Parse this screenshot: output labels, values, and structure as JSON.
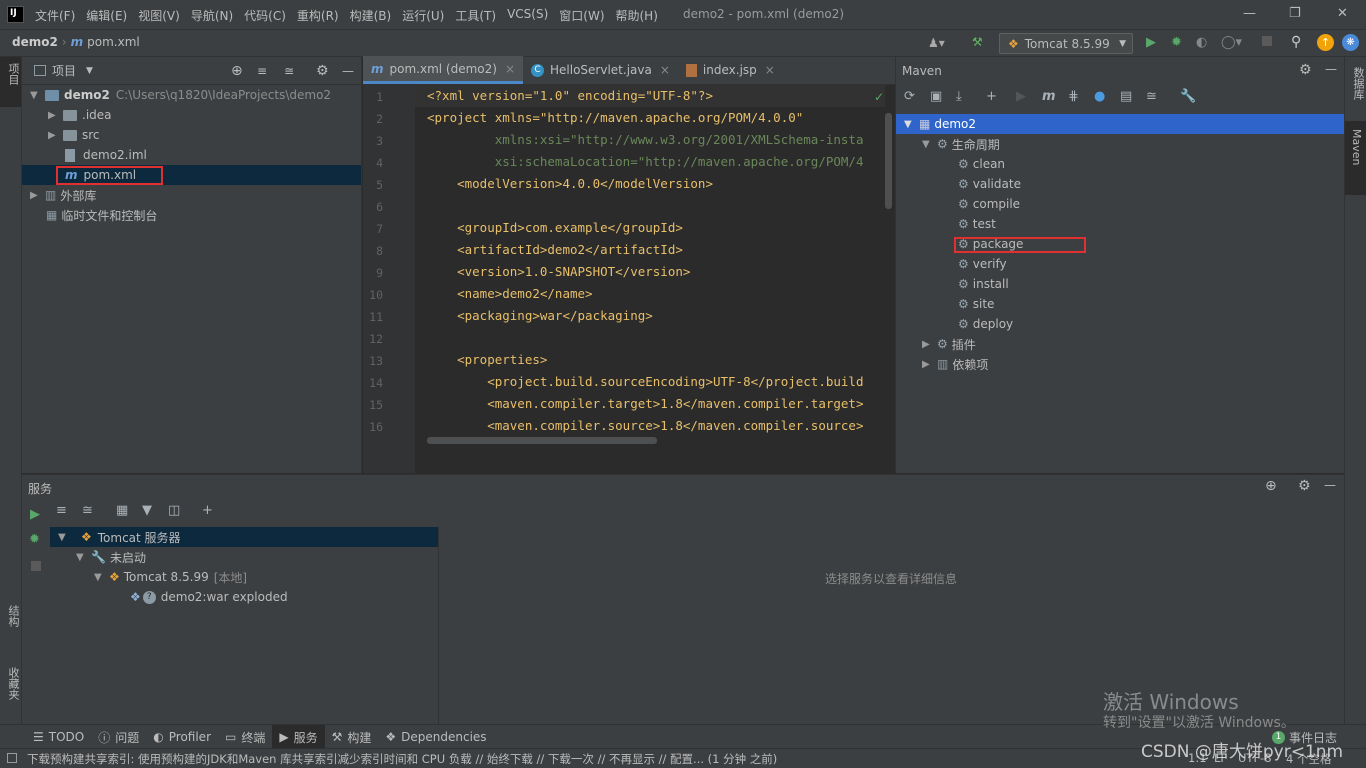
{
  "titlebar": {
    "logo": "IJ",
    "menu": [
      "文件(F)",
      "编辑(E)",
      "视图(V)",
      "导航(N)",
      "代码(C)",
      "重构(R)",
      "构建(B)",
      "运行(U)",
      "工具(T)",
      "VCS(S)",
      "窗口(W)",
      "帮助(H)"
    ],
    "title": "demo2 - pom.xml (demo2)"
  },
  "navbar": {
    "crumb_project": "demo2",
    "crumb_file": "pom.xml",
    "run_config": "Tomcat 8.5.99"
  },
  "left_stripe": {
    "project": "项目",
    "structure": "结构",
    "favorites": "收藏夹"
  },
  "right_stripe": {
    "database": "数据库",
    "maven": "Maven"
  },
  "project": {
    "header": "项目",
    "root_name": "demo2",
    "root_path": "C:\\Users\\q1820\\IdeaProjects\\demo2",
    "items": [
      ".idea",
      "src",
      "demo2.iml",
      "pom.xml",
      "外部库",
      "临时文件和控制台"
    ]
  },
  "editor": {
    "tabs": [
      "pom.xml (demo2)",
      "HelloServlet.java",
      "index.jsp"
    ],
    "line_numbers": [
      "1",
      "2",
      "3",
      "4",
      "5",
      "6",
      "7",
      "8",
      "9",
      "10",
      "11",
      "12",
      "13",
      "14",
      "15",
      "16"
    ],
    "lines": [
      "<?xml version=\"1.0\" encoding=\"UTF-8\"?>",
      "<project xmlns=\"http://maven.apache.org/POM/4.0.0\"",
      "         xmlns:xsi=\"http://www.w3.org/2001/XMLSchema-insta",
      "         xsi:schemaLocation=\"http://maven.apache.org/POM/4",
      "    <modelVersion>4.0.0</modelVersion>",
      "",
      "    <groupId>com.example</groupId>",
      "    <artifactId>demo2</artifactId>",
      "    <version>1.0-SNAPSHOT</version>",
      "    <name>demo2</name>",
      "    <packaging>war</packaging>",
      "",
      "    <properties>",
      "        <project.build.sourceEncoding>UTF-8</project.build",
      "        <maven.compiler.target>1.8</maven.compiler.target>",
      "        <maven.compiler.source>1.8</maven.compiler.source>"
    ]
  },
  "maven": {
    "header": "Maven",
    "root": "demo2",
    "lifecycle": "生命周期",
    "phases": [
      "clean",
      "validate",
      "compile",
      "test",
      "package",
      "verify",
      "install",
      "site",
      "deploy"
    ],
    "plugins": "插件",
    "deps": "依赖项"
  },
  "services": {
    "header": "服务",
    "tomcat_server": "Tomcat 服务器",
    "not_started": "未启动",
    "tomcat_instance": "Tomcat 8.5.99",
    "local_tag": "[本地]",
    "artifact": "demo2:war exploded",
    "detail_hint": "选择服务以查看详细信息"
  },
  "bottom_tabs": [
    "TODO",
    "问题",
    "Profiler",
    "终端",
    "服务",
    "构建",
    "Dependencies"
  ],
  "event_log": "事件日志",
  "event_badge": "1",
  "status": {
    "message": "下载预构建共享索引: 使用预构建的JDK和Maven 库共享索引减少索引时间和 CPU 负载 // 始终下载 // 下载一次 // 不再显示 // 配置... (1 分钟 之前)",
    "position": "1:1",
    "lf": "LF",
    "encoding": "UTF-8",
    "indent": "4 个空格"
  },
  "watermark": {
    "activate_title": "激活 Windows",
    "activate_sub": "转到\"设置\"以激活 Windows。",
    "csdn": "CSDN @唐大饼pyr<1nm"
  },
  "colors": {
    "bg": "#2b2b2b",
    "panel": "#3c3f41",
    "selection": "#2f65ca",
    "highlight_box": "#e03030",
    "tag": "#e8bf6a",
    "string": "#6a8759"
  }
}
